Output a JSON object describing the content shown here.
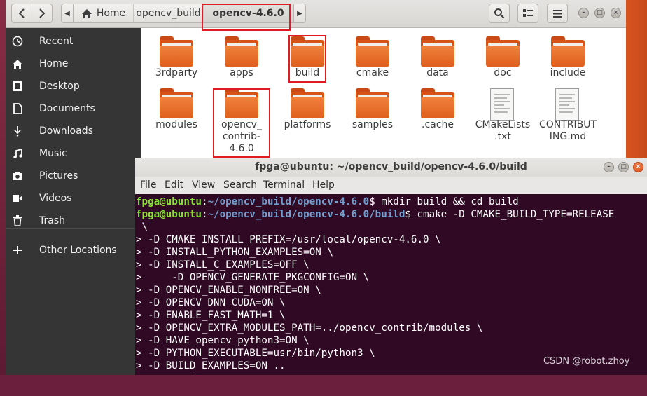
{
  "files": {
    "toolbar": {
      "back_icon": "chevron-left-icon",
      "forward_icon": "chevron-right-icon",
      "home_icon": "home-icon",
      "search_icon": "search-icon",
      "view_icon": "view-options-icon",
      "menu_icon": "hamburger-menu-icon"
    },
    "breadcrumb": [
      "Home",
      "opencv_build",
      "opencv-4.6.0"
    ],
    "sidebar": {
      "items": [
        {
          "label": "Recent",
          "icon": "clock-icon"
        },
        {
          "label": "Home",
          "icon": "home-icon"
        },
        {
          "label": "Desktop",
          "icon": "desktop-icon"
        },
        {
          "label": "Documents",
          "icon": "document-icon"
        },
        {
          "label": "Downloads",
          "icon": "download-icon"
        },
        {
          "label": "Music",
          "icon": "music-icon"
        },
        {
          "label": "Pictures",
          "icon": "camera-icon"
        },
        {
          "label": "Videos",
          "icon": "video-icon"
        },
        {
          "label": "Trash",
          "icon": "trash-icon"
        }
      ],
      "other_locations": {
        "label": "Other Locations",
        "icon": "plus-icon"
      }
    },
    "items": [
      {
        "name": "3rdparty",
        "type": "folder"
      },
      {
        "name": "apps",
        "type": "folder"
      },
      {
        "name": "build",
        "type": "folder"
      },
      {
        "name": "cmake",
        "type": "folder"
      },
      {
        "name": "data",
        "type": "folder"
      },
      {
        "name": "doc",
        "type": "folder"
      },
      {
        "name": "include",
        "type": "folder"
      },
      {
        "name": "modules",
        "type": "folder"
      },
      {
        "name": "opencv_\ncontrib-\n4.6.0",
        "type": "folder"
      },
      {
        "name": "platforms",
        "type": "folder"
      },
      {
        "name": "samples",
        "type": "folder"
      },
      {
        "name": ".cache",
        "type": "folder"
      },
      {
        "name": "CMakeLists\n.txt",
        "type": "file"
      },
      {
        "name": "CONTRIBUT\nING.md",
        "type": "file"
      }
    ]
  },
  "terminal": {
    "title": "fpga@ubuntu: ~/opencv_build/opencv-4.6.0/build",
    "menu": [
      "File",
      "Edit",
      "View",
      "Search",
      "Terminal",
      "Help"
    ],
    "lines": [
      {
        "user": "fpga@ubuntu",
        "sep": ":",
        "path": "~/opencv_build/opencv-4.6.0",
        "cmd": "$ mkdir build && cd build"
      },
      {
        "user": "fpga@ubuntu",
        "sep": ":",
        "path": "~/opencv_build/opencv-4.6.0/build",
        "cmd": "$ cmake -D CMAKE_BUILD_TYPE=RELEASE"
      },
      {
        "text": " \\"
      },
      {
        "text": "> -D CMAKE_INSTALL_PREFIX=/usr/local/opencv-4.6.0 \\"
      },
      {
        "text": "> -D INSTALL_PYTHON_EXAMPLES=ON \\"
      },
      {
        "text": "> -D INSTALL_C_EXAMPLES=OFF \\"
      },
      {
        "text": ">     -D OPENCV_GENERATE_PKGCONFIG=ON \\"
      },
      {
        "text": "> -D OPENCV_ENABLE_NONFREE=ON \\"
      },
      {
        "text": "> -D OPENCV_DNN_CUDA=ON \\"
      },
      {
        "text": "> -D ENABLE_FAST_MATH=1 \\"
      },
      {
        "text": "> -D OPENCV_EXTRA_MODULES_PATH=../opencv_contrib/modules \\"
      },
      {
        "text": "> -D HAVE_opencv_python3=ON \\"
      },
      {
        "text": "> -D PYTHON_EXECUTABLE=usr/bin/python3 \\"
      },
      {
        "text": "> -D BUILD_EXAMPLES=ON .."
      }
    ]
  },
  "watermark": "CSDN @robot.zhoy",
  "colors": {
    "sidebar_bg": "#353535",
    "terminal_bg": "#300a24",
    "prompt_user": "#8ae234",
    "prompt_path": "#729fcf",
    "folder_orange": "#e8692a",
    "highlight_box": "#e01b24"
  }
}
